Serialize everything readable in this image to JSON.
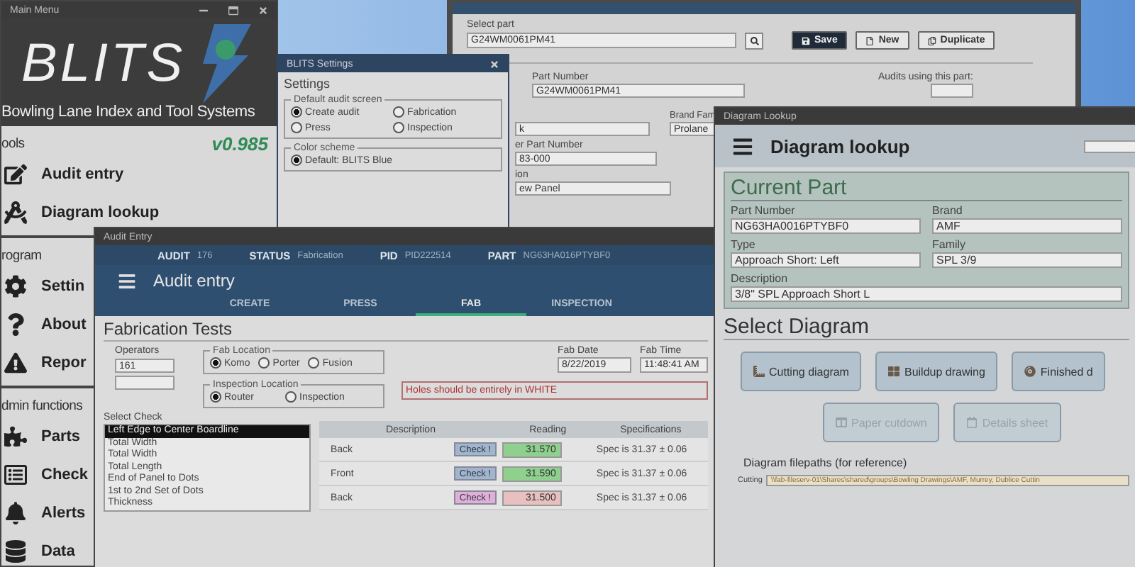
{
  "main_menu": {
    "title": "Main Menu",
    "logo_text": "BLITS",
    "subtitle": "Bowling Lane Index and Tool Systems",
    "version": "v0.985",
    "sections": [
      {
        "heading": "ools",
        "items": [
          {
            "label": "Audit entry"
          },
          {
            "label": "Diagram lookup"
          }
        ]
      },
      {
        "heading": "rogram",
        "items": [
          {
            "label": "Settin"
          },
          {
            "label": "About"
          },
          {
            "label": "Repor"
          }
        ]
      },
      {
        "heading": "dmin functions",
        "items": [
          {
            "label": "Parts"
          },
          {
            "label": "Check"
          },
          {
            "label": "Alerts"
          },
          {
            "label": "Data"
          }
        ]
      }
    ]
  },
  "part_editor": {
    "select_label": "Select part",
    "select_value": "G24WM0061PM41",
    "buttons": [
      {
        "label": "Save",
        "primary": true
      },
      {
        "label": "New",
        "primary": false
      },
      {
        "label": "Duplicate",
        "primary": false
      }
    ],
    "part_number_label": "Part Number",
    "part_number_value": "G24WM0061PM41",
    "audits_label": "Audits using this part:",
    "field_3_value": "k",
    "brand_label": "Brand Fam",
    "brand_value": "Prolane",
    "field_4_label": "er Part Number",
    "field_4_value": "83-000",
    "field_5_label": "ion",
    "field_5_value": "ew Panel"
  },
  "settings_window": {
    "title": "BLITS Settings",
    "heading": "Settings",
    "groups": [
      {
        "legend": "Default audit screen",
        "options": [
          {
            "label": "Create audit",
            "selected": true
          },
          {
            "label": "Fabrication",
            "selected": false
          },
          {
            "label": "Press",
            "selected": false
          },
          {
            "label": "Inspection",
            "selected": false
          }
        ]
      },
      {
        "legend": "Color scheme",
        "options": [
          {
            "label": "Default: BLITS Blue",
            "selected": true
          }
        ]
      }
    ]
  },
  "audit_entry": {
    "title": "Audit Entry",
    "info": [
      {
        "label": "AUDIT",
        "value": "176"
      },
      {
        "label": "STATUS",
        "value": "Fabrication"
      },
      {
        "label": "PID",
        "value": "PID222514"
      },
      {
        "label": "PART",
        "value": "NG63HA016PTYBF0"
      }
    ],
    "heading": "Audit entry",
    "tabs": [
      {
        "label": "CREATE",
        "selected": false
      },
      {
        "label": "PRESS",
        "selected": false
      },
      {
        "label": "FAB",
        "selected": true
      },
      {
        "label": "INSPECTION",
        "selected": false
      }
    ],
    "section_title": "Fabrication Tests",
    "operators": {
      "label": "Operators",
      "values": [
        "161"
      ]
    },
    "fab_location": {
      "legend": "Fab Location",
      "options": [
        {
          "label": "Komo",
          "selected": true
        },
        {
          "label": "Porter",
          "selected": false
        },
        {
          "label": "Fusion",
          "selected": false
        }
      ]
    },
    "inspection_location": {
      "legend": "Inspection Location",
      "options": [
        {
          "label": "Router",
          "selected": true
        },
        {
          "label": "Inspection",
          "selected": false
        }
      ]
    },
    "fab_date": {
      "label": "Fab Date",
      "value": "8/22/2019"
    },
    "fab_time": {
      "label": "Fab Time",
      "value": "11:48:41 AM"
    },
    "note": "Holes should be entirely in WHITE",
    "checks": {
      "label": "Select Check",
      "items": [
        {
          "label": "Left Edge to Center Boardline",
          "selected": true
        },
        {
          "label": "Total Width",
          "selected": false
        },
        {
          "label": "Total Width",
          "selected": false
        },
        {
          "label": "Total Length",
          "selected": false
        },
        {
          "label": "End of Panel to Dots",
          "selected": false
        },
        {
          "label": "1st to 2nd Set of Dots",
          "selected": false
        },
        {
          "label": "Thickness",
          "selected": false
        }
      ]
    },
    "table": {
      "columns": [
        "Description",
        "Reading",
        "Specifications"
      ],
      "rows": [
        {
          "description": "Back",
          "check": "Check !",
          "kind": "pass",
          "reading": "31.570",
          "color": "#8fd08f",
          "spec": "Spec is  31.37 ± 0.06"
        },
        {
          "description": "Front",
          "check": "Check !",
          "kind": "pass",
          "reading": "31.590",
          "color": "#8fd08f",
          "spec": "Spec is  31.37 ± 0.06"
        },
        {
          "description": "Back",
          "check": "Check !",
          "kind": "fail",
          "reading": "31.500",
          "color": "#e8c0c0",
          "spec": "Spec is  31.37 ± 0.06"
        }
      ]
    }
  },
  "diagram_lookup": {
    "title": "Diagram Lookup",
    "heading": "Diagram lookup",
    "current_part": {
      "title": "Current Part",
      "fields": [
        {
          "label": "Part Number",
          "value": "NG63HA0016PTYBF0"
        },
        {
          "label": "Brand",
          "value": "AMF"
        },
        {
          "label": "Type",
          "value": "Approach Short: Left"
        },
        {
          "label": "Family",
          "value": "SPL 3/9"
        },
        {
          "label": "Description",
          "value": "3/8\" SPL Approach Short L"
        }
      ]
    },
    "select_title": "Select Diagram",
    "buttons": [
      {
        "label": "Cutting diagram",
        "disabled": false
      },
      {
        "label": "Buildup drawing",
        "disabled": false
      },
      {
        "label": "Finished d",
        "disabled": false
      },
      {
        "label": "Paper cutdown",
        "disabled": true
      },
      {
        "label": "Details sheet",
        "disabled": true
      }
    ],
    "filepaths_title": "Diagram filepaths (for reference)",
    "paths": [
      {
        "label": "Cutting",
        "value": "\\\\fab-fileserv-01\\Shares\\shared\\groups\\Bowling Drawings\\AMF, Murrey, Dublice Cuttin"
      }
    ]
  }
}
